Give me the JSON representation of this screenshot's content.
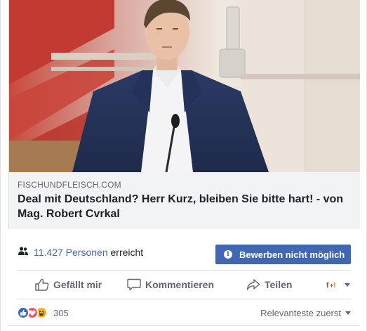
{
  "preview": {
    "domain": "FISCHUNDFLEISCH.COM",
    "headline": "Deal mit Deutschland? Herr Kurz, bleiben Sie bitte hart! - von Mag. Robert Cvrkal"
  },
  "reach": {
    "count": "11.427 Personen",
    "suffix": " erreicht",
    "boost_label": "Bewerben nicht möglich"
  },
  "actions": {
    "like": "Gefällt mir",
    "comment": "Kommentieren",
    "share": "Teilen"
  },
  "reactions": {
    "count": "305",
    "sort_label": "Relevanteste zuerst"
  },
  "colors": {
    "accent": "#4267b2",
    "love": "#f25268",
    "haha": "#f7b125"
  },
  "icons": [
    "people-icon",
    "info-icon",
    "like-icon",
    "comment-icon",
    "share-icon",
    "page-avatar-icon",
    "chevron-down-icon",
    "reaction-like-icon",
    "reaction-love-icon",
    "reaction-haha-icon"
  ]
}
